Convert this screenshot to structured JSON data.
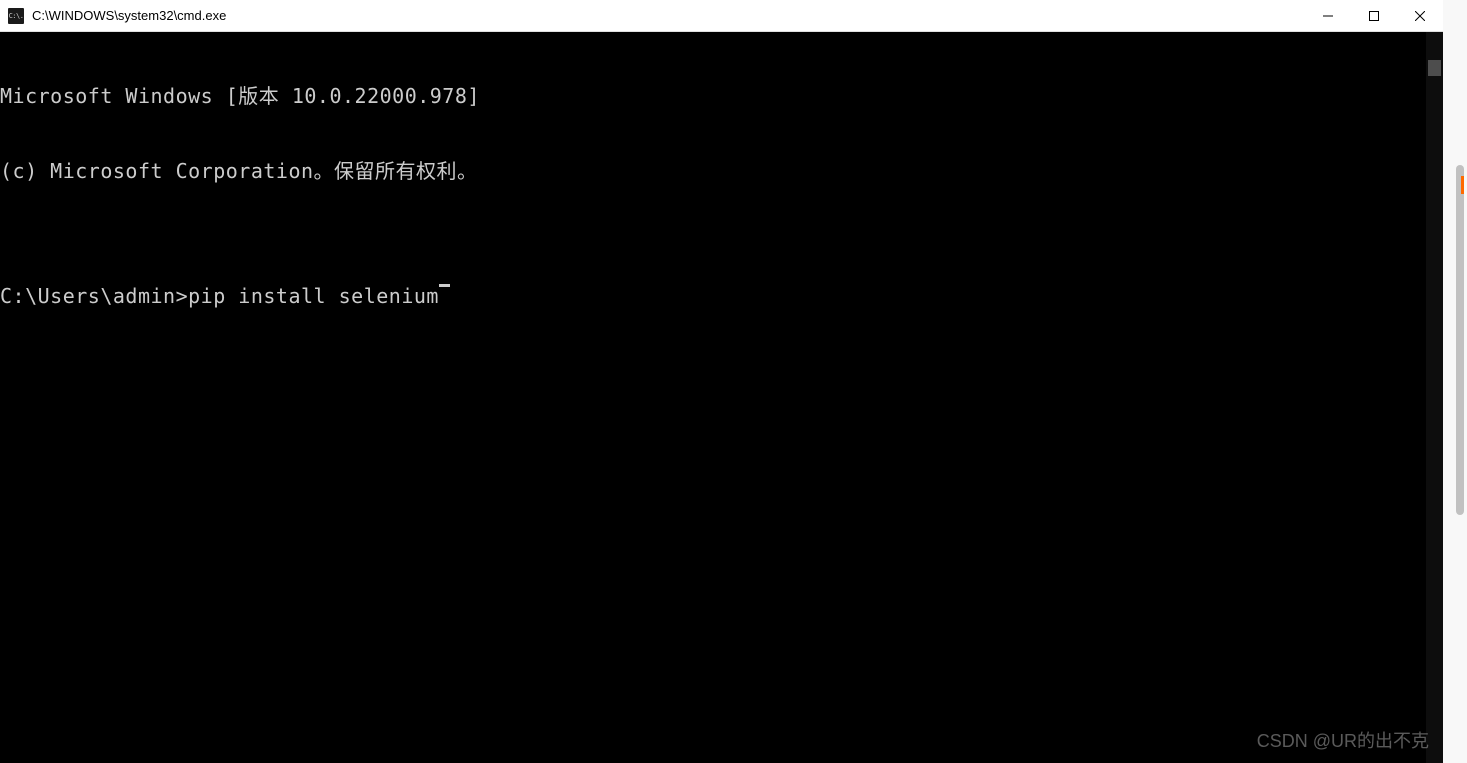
{
  "window": {
    "title": "C:\\WINDOWS\\system32\\cmd.exe",
    "icon_label": "C:\\."
  },
  "terminal": {
    "lines": [
      "Microsoft Windows [版本 10.0.22000.978]",
      "(c) Microsoft Corporation。保留所有权利。",
      "",
      ""
    ],
    "prompt": "C:\\Users\\admin>",
    "command": "pip install selenium"
  },
  "watermark": "CSDN @UR的出不克"
}
